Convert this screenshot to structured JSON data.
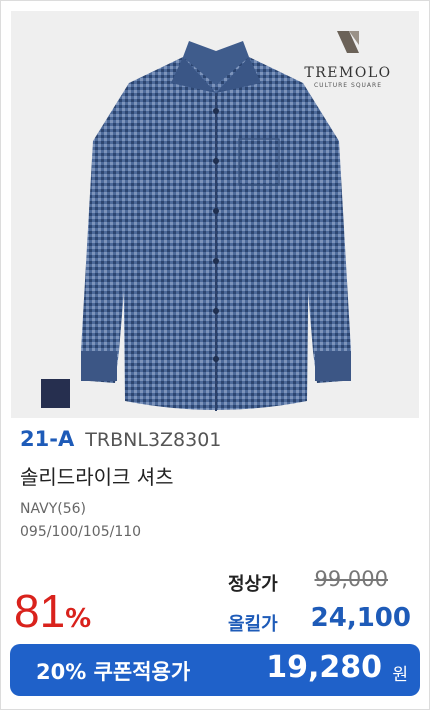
{
  "brand": {
    "name": "TREMOLO",
    "subtitle": "CULTURE SQUARE"
  },
  "product": {
    "series": "21-A",
    "code": "TRBNL3Z8301",
    "name": "솔리드라이크 셔츠",
    "color": "NAVY(56)",
    "sizes": "095/100/105/110",
    "swatch_color": "#262f4f"
  },
  "pricing": {
    "discount": "81",
    "discount_unit": "%",
    "original_label": "정상가",
    "original_price": "99,000",
    "sale_label": "올킬가",
    "sale_price": "24,100",
    "coupon_label": "20% 쿠폰적용가",
    "coupon_price": "19,280",
    "coupon_unit": "원"
  },
  "colors": {
    "accent": "#1e5bb8",
    "discount": "#d9221c",
    "coupon_bg": "#1f61c9"
  }
}
